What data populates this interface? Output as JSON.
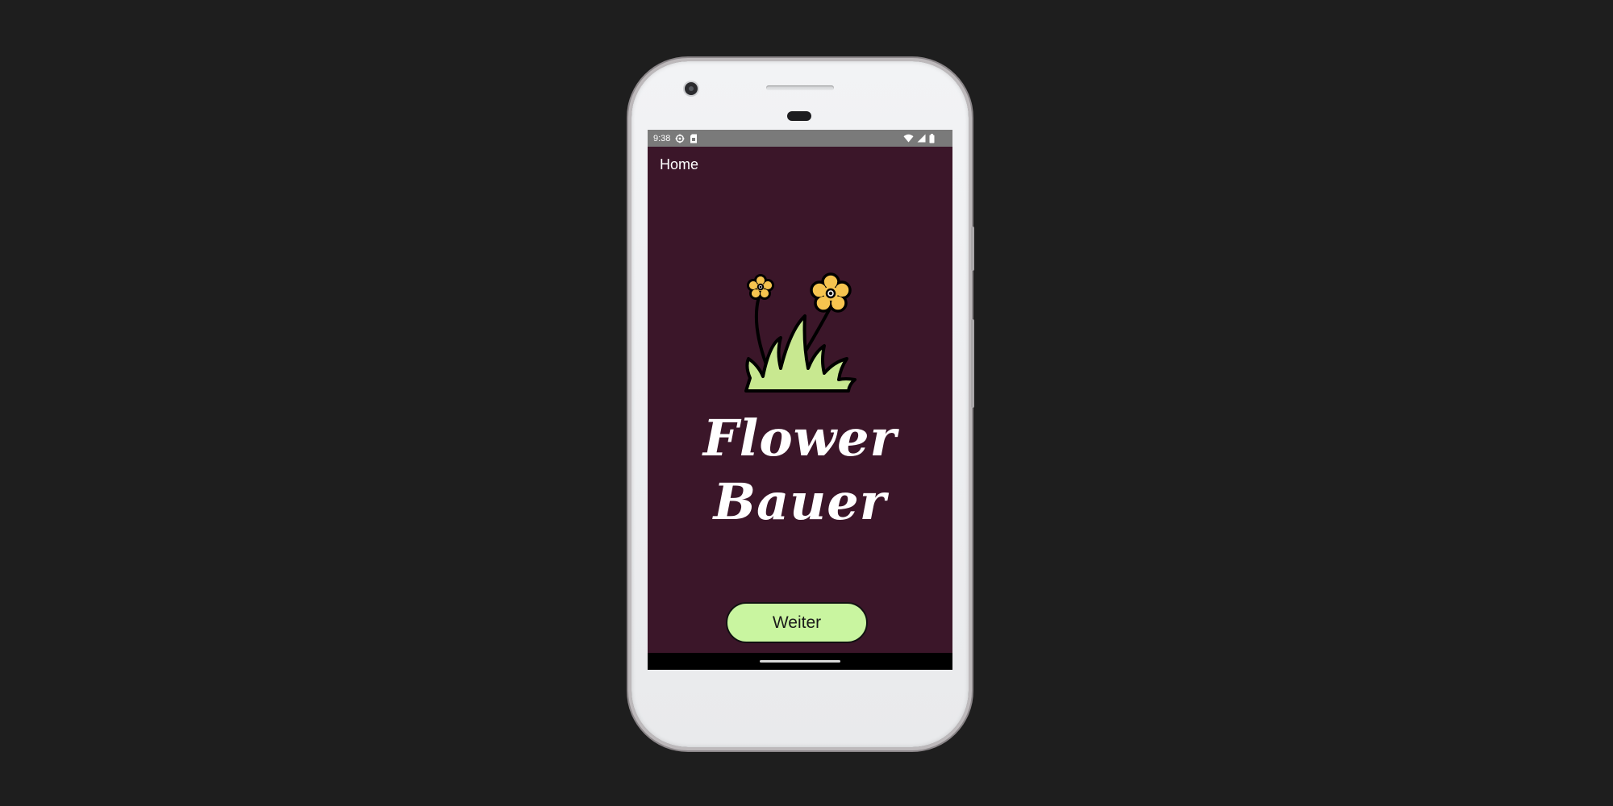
{
  "status_bar": {
    "time": "9:38",
    "icons": [
      "location-icon",
      "sim-card-icon",
      "wifi-icon",
      "signal-icon",
      "battery-icon"
    ]
  },
  "screen": {
    "title": "Home",
    "app_name_line1": "Flower",
    "app_name_line2": "Bauer",
    "next_button_label": "Weiter"
  },
  "illustration": {
    "name": "flowers-and-grass-illustration",
    "flower_color": "#f6c44f",
    "grass_color": "#c8e890"
  },
  "colors": {
    "background": "#1e1e1e",
    "screen_background": "#3b1629",
    "status_bar": "#7a7a7a",
    "button": "#c9f5a0"
  }
}
